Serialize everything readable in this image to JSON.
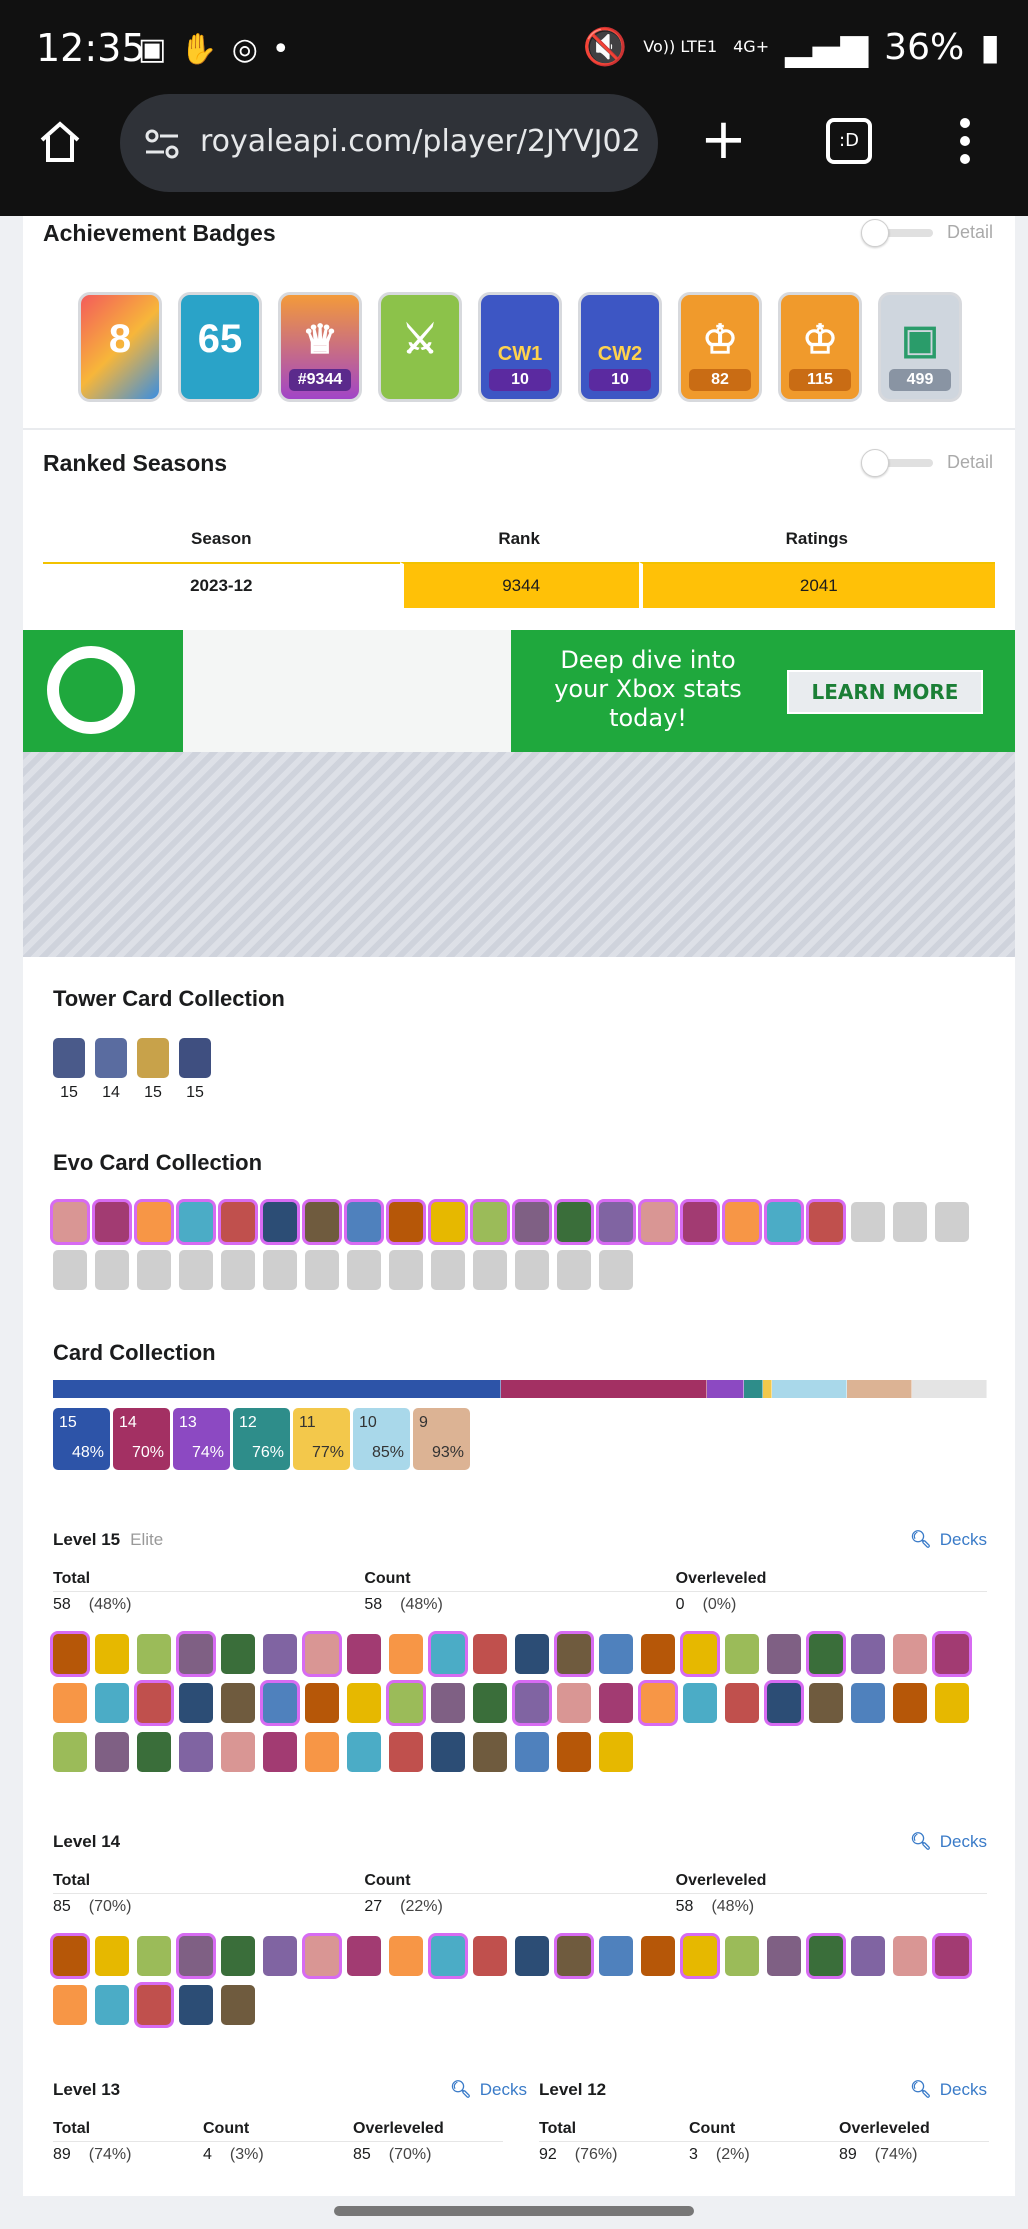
{
  "statusbar": {
    "time": "12:35",
    "volte": "Vo)) LTE1",
    "net": "4G+",
    "battery": "36%"
  },
  "browser": {
    "url": "royaleapi.com/player/2JYVJ02",
    "tabs_label": ":D"
  },
  "achievements": {
    "title": "Achievement Badges",
    "toggle_label": "Detail",
    "badges": [
      {
        "label": "",
        "glyph": "8"
      },
      {
        "label": "",
        "glyph": "65"
      },
      {
        "label": "#9344",
        "glyph": "♛"
      },
      {
        "label": "",
        "glyph": "⚔"
      },
      {
        "label": "10",
        "glyph": "CW1"
      },
      {
        "label": "10",
        "glyph": "CW2"
      },
      {
        "label": "82",
        "glyph": "♔"
      },
      {
        "label": "115",
        "glyph": "♔"
      },
      {
        "label": "499",
        "glyph": "▣"
      }
    ]
  },
  "ranked": {
    "title": "Ranked Seasons",
    "toggle_label": "Detail",
    "headers": [
      "Season",
      "Rank",
      "Ratings"
    ],
    "row": {
      "season": "2023-12",
      "rank": "9344",
      "ratings": "2041"
    }
  },
  "ad": {
    "text": "Deep dive into your Xbox stats today!",
    "button": "LEARN MORE"
  },
  "tower": {
    "title": "Tower Card Collection",
    "levels": [
      "15",
      "14",
      "15",
      "15"
    ]
  },
  "evo": {
    "title": "Evo Card Collection"
  },
  "cards": {
    "title": "Card Collection",
    "tiles": [
      {
        "level": "15",
        "pct": "48%",
        "color": "#2d54a8"
      },
      {
        "level": "14",
        "pct": "70%",
        "color": "#a33063"
      },
      {
        "level": "13",
        "pct": "74%",
        "color": "#8c49c2"
      },
      {
        "level": "12",
        "pct": "76%",
        "color": "#2e8d8a"
      },
      {
        "level": "11",
        "pct": "77%",
        "color": "#f3c84b"
      },
      {
        "level": "10",
        "pct": "85%",
        "color": "#a9d8ea"
      },
      {
        "level": "9",
        "pct": "93%",
        "color": "#dcb394"
      }
    ],
    "bar_fractions": [
      0.48,
      0.22,
      0.04,
      0.02,
      0.01,
      0.08,
      0.07,
      0.08
    ]
  },
  "decks_label": "Decks",
  "stat_headers": [
    "Total",
    "Count",
    "Overleveled"
  ],
  "level15": {
    "title": "Level 15",
    "subtitle": "Elite",
    "total": "58",
    "total_pct": "(48%)",
    "count": "58",
    "count_pct": "(48%)",
    "over": "0",
    "over_pct": "(0%)"
  },
  "level14": {
    "title": "Level 14",
    "total": "85",
    "total_pct": "(70%)",
    "count": "27",
    "count_pct": "(22%)",
    "over": "58",
    "over_pct": "(48%)"
  },
  "level13": {
    "title": "Level 13",
    "total": "89",
    "total_pct": "(74%)",
    "count": "4",
    "count_pct": "(3%)",
    "over": "85",
    "over_pct": "(70%)"
  },
  "level12": {
    "title": "Level 12",
    "total": "92",
    "total_pct": "(76%)",
    "count": "3",
    "count_pct": "(2%)",
    "over": "89",
    "over_pct": "(74%)"
  }
}
